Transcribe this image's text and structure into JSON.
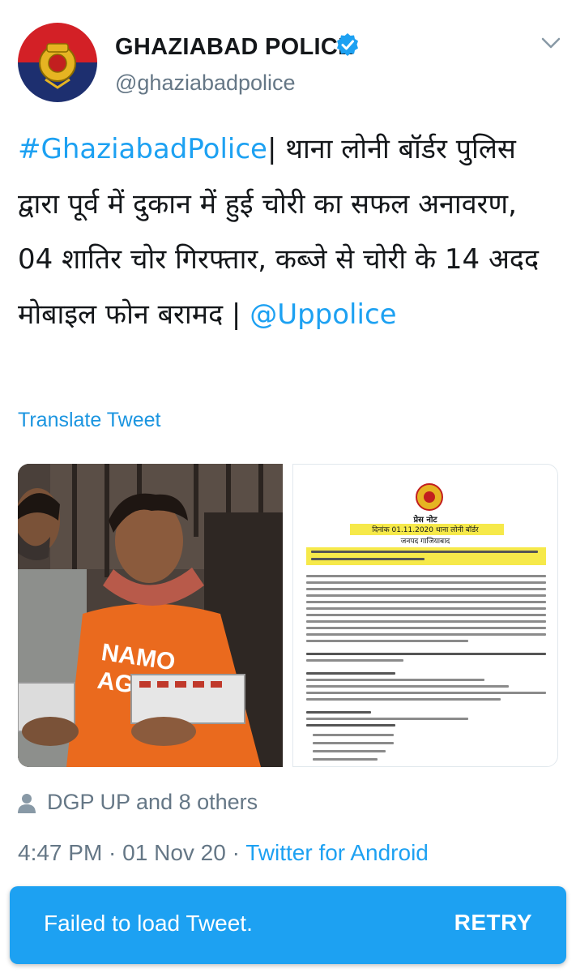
{
  "profile": {
    "name": "GHAZIABAD POLICE",
    "handle": "@ghaziabadpolice",
    "avatar_icon": "up-police-emblem-icon",
    "verified_icon": "verified-badge-icon"
  },
  "tweet": {
    "hashtag": "#GhaziabadPolice",
    "body": "| थाना लोनी बॉर्डर पुलिस द्वारा पूर्व में दुकान में हुई चोरी का सफल अनावरण, 04 शातिर चोर गिरफ्तार, कब्जे से चोरी के 14 अदद मोबाइल फोन बरामद | ",
    "mention": "@Uppolice",
    "translate_label": "Translate Tweet"
  },
  "media": {
    "photo": {
      "shirt_line1": "NAMO",
      "shirt_line2": "AGAIN!"
    },
    "press_note": {
      "heading": "प्रेस नोट",
      "subheading": "दिनांक 01.11.2020 थाना लोनी बॉर्डर",
      "subheading2": "जनपद गाजियाबाद"
    }
  },
  "engagement": {
    "likes_text": "DGP UP and 8 others"
  },
  "meta": {
    "time": "4:47 PM",
    "date": "01 Nov 20",
    "separator": " · ",
    "source": "Twitter for Android"
  },
  "snackbar": {
    "message": "Failed to load Tweet.",
    "action": "RETRY"
  },
  "colors": {
    "link": "#1da1f2",
    "secondary_text": "#657786",
    "snackbar_bg": "#1da1f2"
  }
}
